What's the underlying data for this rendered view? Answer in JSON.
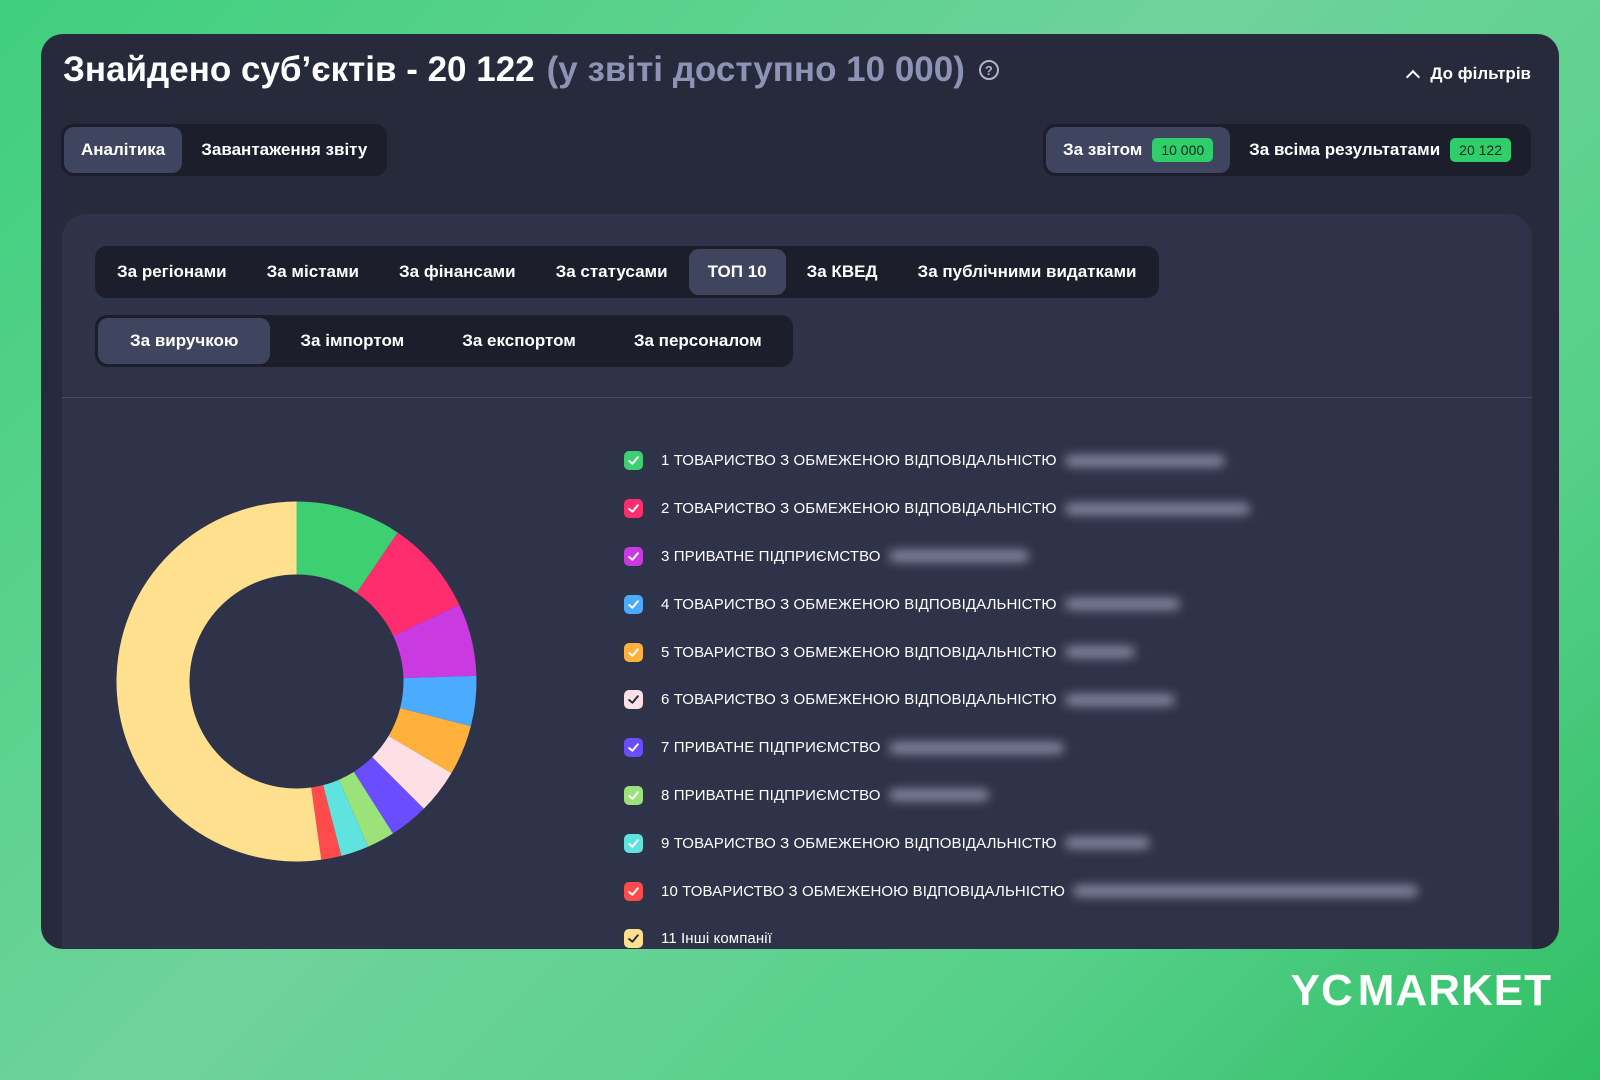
{
  "header": {
    "title": "Знайдено суб’єктів - 20 122",
    "subtitle": "(у звіті доступно 10 000)",
    "help_icon": "question-circle-icon",
    "back_to_filters": "До фільтрів"
  },
  "view_tabs": [
    {
      "label": "Аналітика",
      "active": true
    },
    {
      "label": "Завантаження звіту",
      "active": false
    }
  ],
  "scope_tabs": [
    {
      "label": "За звітом",
      "count": "10 000",
      "active": true
    },
    {
      "label": "За всіма результатами",
      "count": "20 122",
      "active": false
    }
  ],
  "category_tabs": [
    {
      "label": "За регіонами",
      "active": false
    },
    {
      "label": "За містами",
      "active": false
    },
    {
      "label": "За фінансами",
      "active": false
    },
    {
      "label": "За статусами",
      "active": false
    },
    {
      "label": "ТОП 10",
      "active": true
    },
    {
      "label": "За КВЕД",
      "active": false
    },
    {
      "label": "За публічними видатками",
      "active": false
    }
  ],
  "sub_tabs": [
    {
      "label": "За виручкою",
      "active": true
    },
    {
      "label": "За імпортом",
      "active": false
    },
    {
      "label": "За експортом",
      "active": false
    },
    {
      "label": "За персоналом",
      "active": false
    }
  ],
  "legend": [
    {
      "label": "1 ТОВАРИСТВО З ОБМЕЖЕНОЮ ВІДПОВІДАЛЬНІСТЮ",
      "color": "#3ecf72",
      "checked": true
    },
    {
      "label": "2 ТОВАРИСТВО З ОБМЕЖЕНОЮ ВІДПОВІДАЛЬНІСТЮ",
      "color": "#ff2d6e",
      "checked": true
    },
    {
      "label": "3 ПРИВАТНЕ ПІДПРИЄМСТВО",
      "color": "#c93be0",
      "checked": true
    },
    {
      "label": "4 ТОВАРИСТВО З ОБМЕЖЕНОЮ ВІДПОВІДАЛЬНІСТЮ",
      "color": "#4aabff",
      "checked": true
    },
    {
      "label": "5 ТОВАРИСТВО З ОБМЕЖЕНОЮ ВІДПОВІДАЛЬНІСТЮ",
      "color": "#ffb13b",
      "checked": true
    },
    {
      "label": "6 ТОВАРИСТВО З ОБМЕЖЕНОЮ ВІДПОВІДАЛЬНІСТЮ",
      "color": "#fde0e6",
      "checked": true
    },
    {
      "label": "7 ПРИВАТНЕ ПІДПРИЄМСТВО",
      "color": "#6a4dff",
      "checked": true
    },
    {
      "label": "8 ПРИВАТНЕ ПІДПРИЄМСТВО",
      "color": "#9be27a",
      "checked": true
    },
    {
      "label": "9 ТОВАРИСТВО З ОБМЕЖЕНОЮ ВІДПОВІДАЛЬНІСТЮ",
      "color": "#5ee3de",
      "checked": true
    },
    {
      "label": "10 ТОВАРИСТВО З ОБМЕЖЕНОЮ ВІДПОВІДАЛЬНІСТЮ",
      "color": "#ff4b4b",
      "checked": true
    },
    {
      "label": "11 Інші компанії",
      "color": "#ffe08e",
      "checked": true
    }
  ],
  "chart_data": {
    "type": "pie",
    "categories": [
      "1",
      "2",
      "3",
      "4",
      "5",
      "6",
      "7",
      "8",
      "9",
      "10",
      "11"
    ],
    "values": [
      9.5,
      8.5,
      6.5,
      4.5,
      4.5,
      4.0,
      3.5,
      2.5,
      2.5,
      1.8,
      52.2
    ],
    "colors": [
      "#3ecf72",
      "#ff2d6e",
      "#c93be0",
      "#4aabff",
      "#ffb13b",
      "#fde0e6",
      "#6a4dff",
      "#9be27a",
      "#5ee3de",
      "#ff4b4b",
      "#ffe08e"
    ],
    "donut": true
  },
  "brand": {
    "text_left": "YC",
    "text_right": "MARKET"
  }
}
